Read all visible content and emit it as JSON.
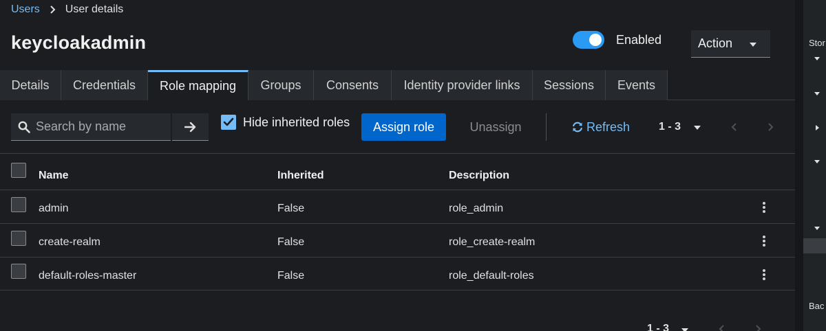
{
  "breadcrumb": {
    "parent": "Users",
    "current": "User details"
  },
  "page": {
    "title": "keycloakadmin"
  },
  "header": {
    "enabled_label": "Enabled",
    "enabled": true,
    "action_label": "Action"
  },
  "tabs": [
    {
      "label": "Details"
    },
    {
      "label": "Credentials"
    },
    {
      "label": "Role mapping",
      "active": true
    },
    {
      "label": "Groups"
    },
    {
      "label": "Consents"
    },
    {
      "label": "Identity provider links"
    },
    {
      "label": "Sessions"
    },
    {
      "label": "Events"
    }
  ],
  "toolbar": {
    "search_placeholder": "Search by name",
    "hide_inherited_label": "Hide inherited roles",
    "hide_inherited_checked": true,
    "assign_label": "Assign role",
    "unassign_label": "Unassign",
    "refresh_label": "Refresh",
    "pager": "1 - 3"
  },
  "table": {
    "headers": {
      "name": "Name",
      "inherited": "Inherited",
      "description": "Description"
    },
    "rows": [
      {
        "name": "admin",
        "inherited": "False",
        "description": "role_admin"
      },
      {
        "name": "create-realm",
        "inherited": "False",
        "description": "role_create-realm"
      },
      {
        "name": "default-roles-master",
        "inherited": "False",
        "description": "role_default-roles"
      }
    ]
  },
  "footer": {
    "pager": "1 - 3"
  },
  "side_panel": {
    "top_text": "Stor",
    "bottom_text": "Bac"
  },
  "colors": {
    "accent": "#73bcf7",
    "primary": "#0066cc",
    "background": "#1b1d21"
  }
}
